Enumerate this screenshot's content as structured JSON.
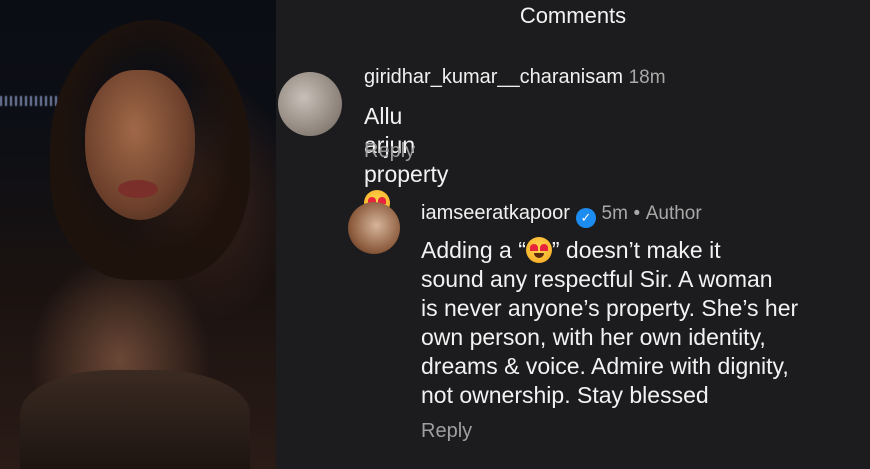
{
  "header": {
    "title": "Comments"
  },
  "comments": [
    {
      "username": "giridhar_kumar__charanisam",
      "time": "18m",
      "text_before_emoji": "Allu arjun property",
      "emoji": "heart-eyes",
      "reply_label": "Reply"
    },
    {
      "username": "iamseeratkapoor",
      "time": "5m",
      "separator": "•",
      "role": "Author",
      "verified": true,
      "text_lines": [
        "Adding a “",
        "” doesn’t make it",
        "sound any respectful Sir. A woman",
        "is never anyone’s property. She’s her",
        "own person, with her own identity,",
        "dreams & voice. Admire with dignity,",
        "not ownership. Stay blessed"
      ],
      "reply_label": "Reply"
    }
  ],
  "colors": {
    "background": "#1c1c1e",
    "verified": "#1d8cf0",
    "text": "#f2f2f2",
    "muted": "#a8a8a8"
  }
}
